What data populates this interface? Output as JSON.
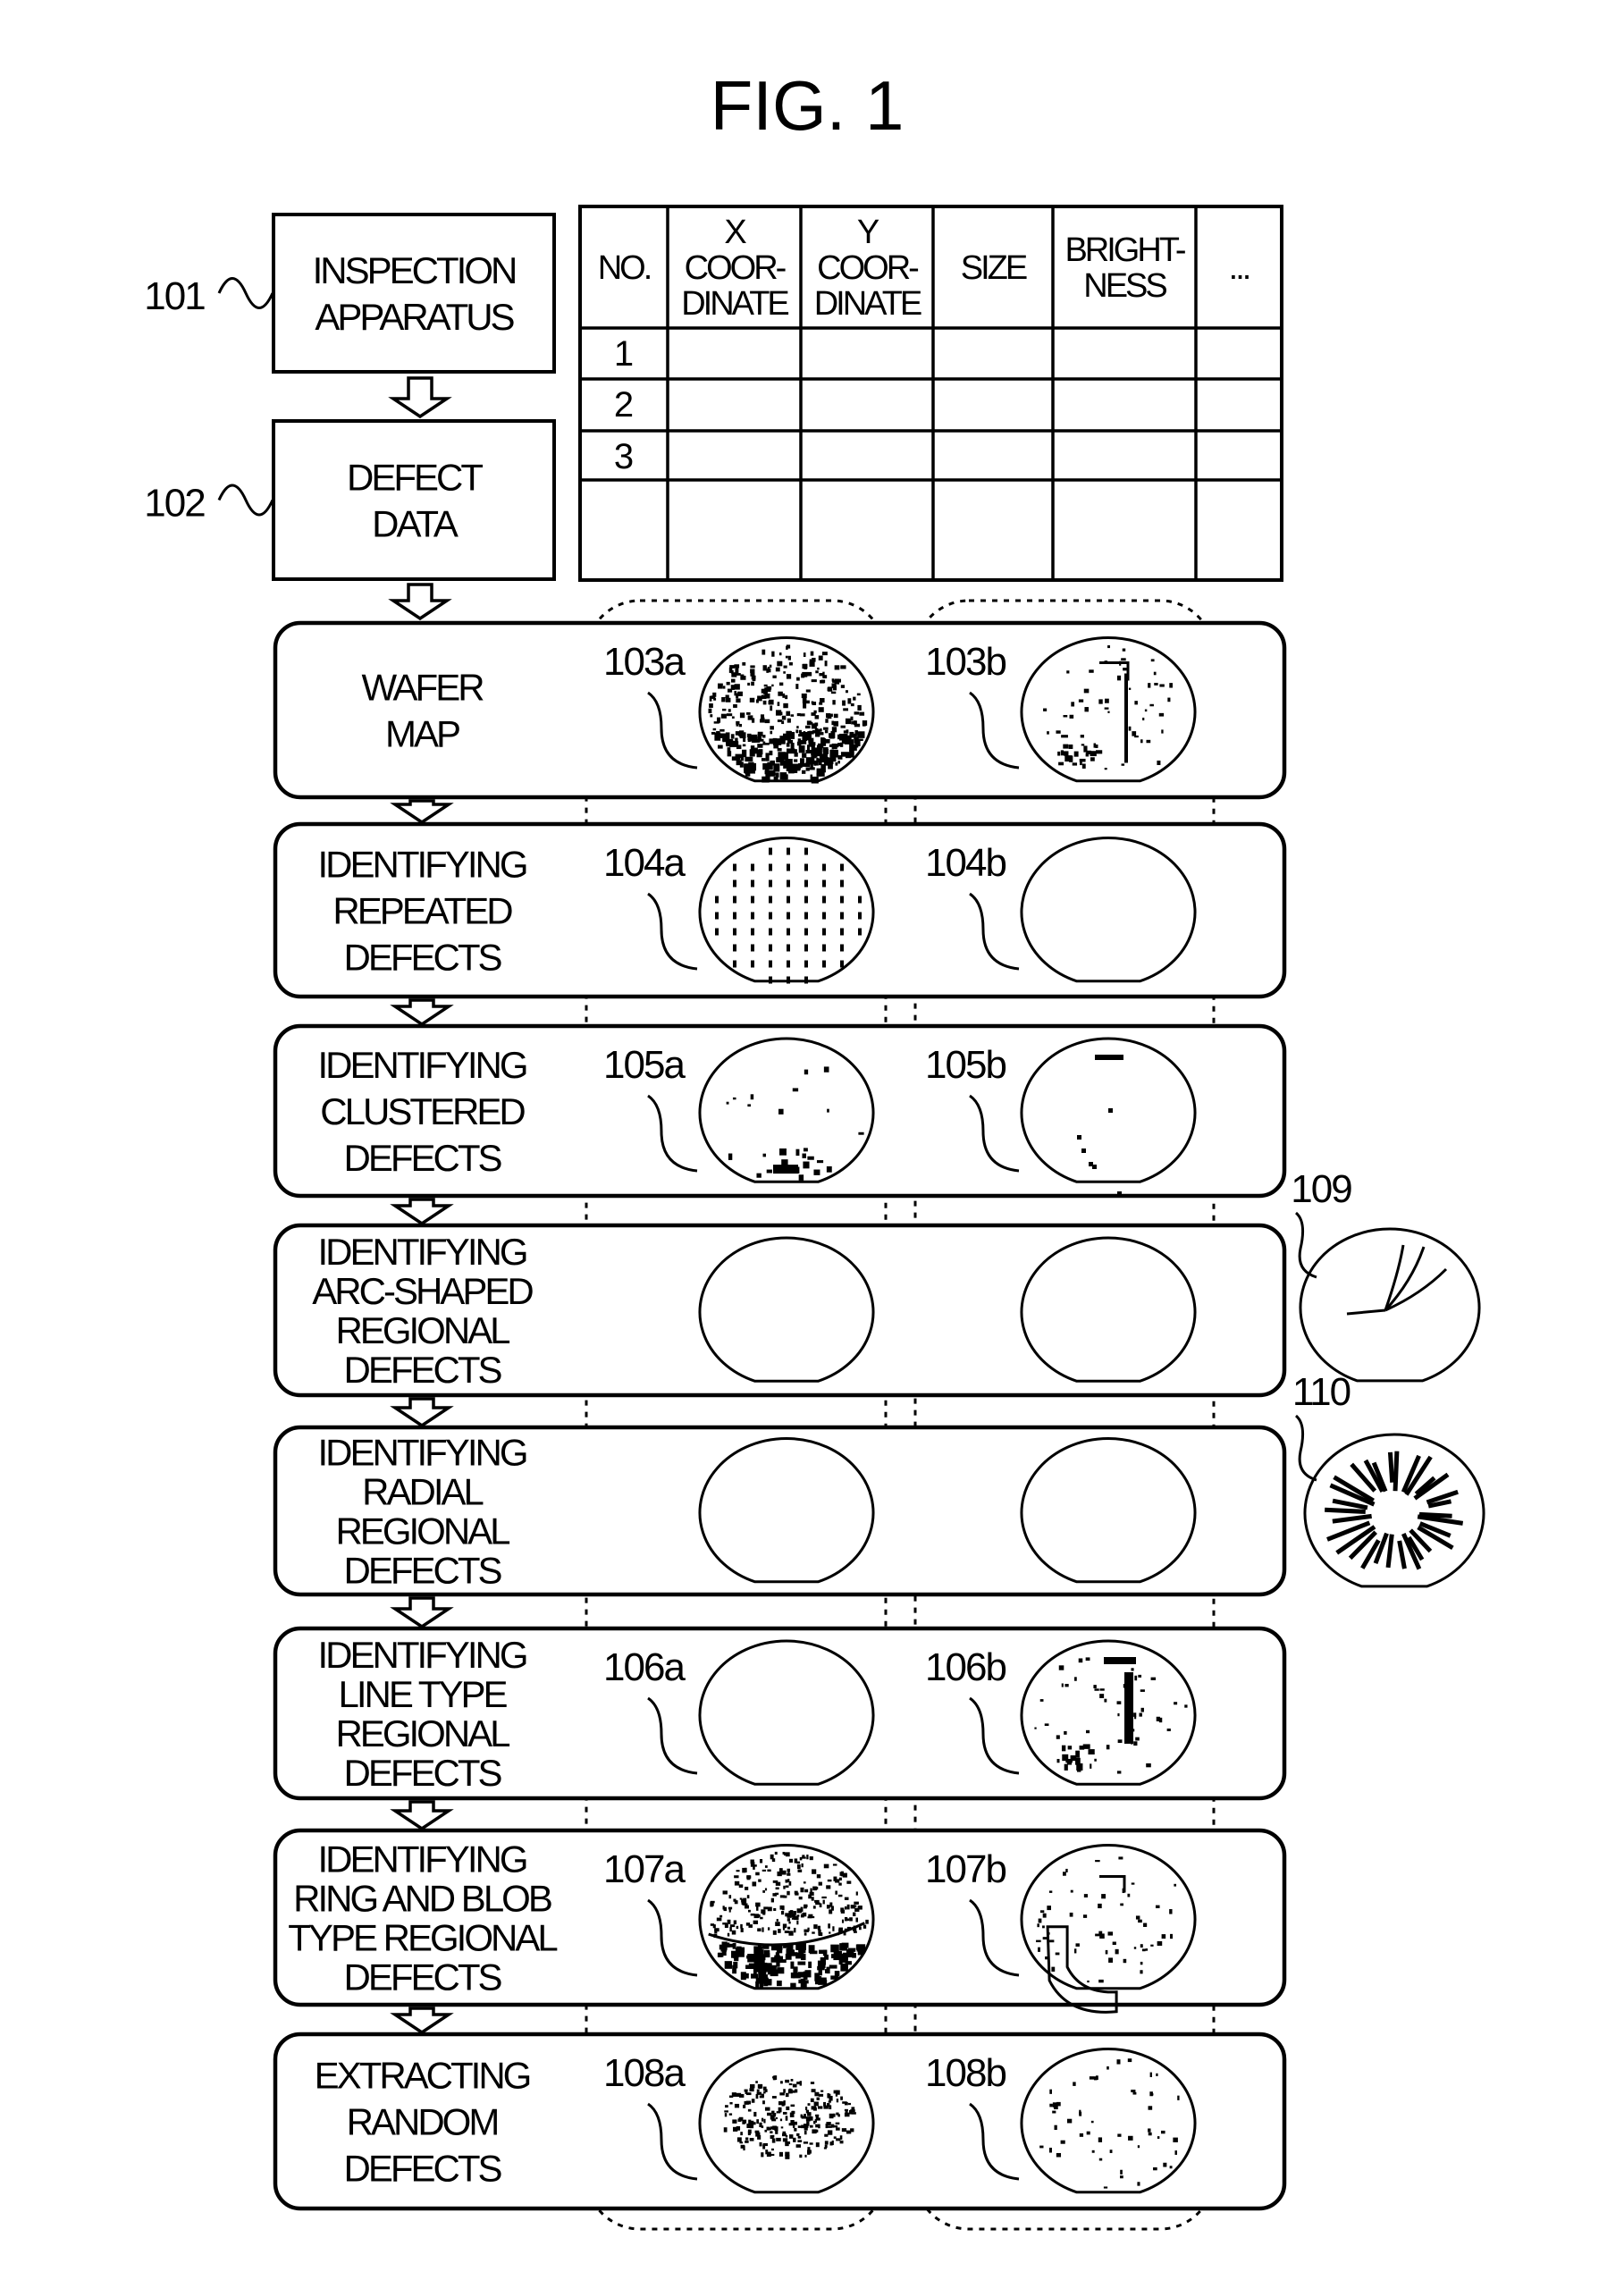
{
  "figure_title": "FIG. 1",
  "input_blocks": [
    {
      "ref": "101",
      "lines": [
        "INSPECTION",
        "APPARATUS"
      ]
    },
    {
      "ref": "102",
      "lines": [
        "DEFECT",
        "DATA"
      ]
    }
  ],
  "defect_table": {
    "columns": [
      {
        "lines": [
          "NO."
        ]
      },
      {
        "lines": [
          "X",
          "COOR-",
          "DINATE"
        ]
      },
      {
        "lines": [
          "Y",
          "COOR-",
          "DINATE"
        ]
      },
      {
        "lines": [
          "SIZE"
        ]
      },
      {
        "lines": [
          "BRIGHT-",
          "NESS"
        ]
      },
      {
        "lines": [
          "..."
        ]
      }
    ],
    "rows": [
      [
        "1",
        "",
        "",
        "",
        "",
        ""
      ],
      [
        "2",
        "",
        "",
        "",
        "",
        ""
      ],
      [
        "3",
        "",
        "",
        "",
        "",
        ""
      ],
      [
        "",
        "",
        "",
        "",
        "",
        ""
      ]
    ]
  },
  "stages": [
    {
      "lines": [
        "WAFER",
        "MAP"
      ],
      "wafer_a": {
        "ref": "103a",
        "pattern": "dense-bottom"
      },
      "wafer_b": {
        "ref": "103b",
        "pattern": "sparse-with-line"
      }
    },
    {
      "lines": [
        "IDENTIFYING",
        "REPEATED",
        "DEFECTS"
      ],
      "wafer_a": {
        "ref": "104a",
        "pattern": "grid"
      },
      "wafer_b": {
        "ref": "104b",
        "pattern": "empty"
      }
    },
    {
      "lines": [
        "IDENTIFYING",
        "CLUSTERED",
        "DEFECTS"
      ],
      "wafer_a": {
        "ref": "105a",
        "pattern": "clusters-bottom"
      },
      "wafer_b": {
        "ref": "105b",
        "pattern": "few-clusters"
      }
    },
    {
      "lines": [
        "IDENTIFYING",
        "ARC-SHAPED",
        "REGIONAL",
        "DEFECTS"
      ],
      "wafer_a": {
        "ref": "",
        "pattern": "empty"
      },
      "wafer_b": {
        "ref": "",
        "pattern": "empty"
      }
    },
    {
      "lines": [
        "IDENTIFYING",
        "RADIAL",
        "REGIONAL",
        "DEFECTS"
      ],
      "wafer_a": {
        "ref": "",
        "pattern": "empty"
      },
      "wafer_b": {
        "ref": "",
        "pattern": "empty"
      }
    },
    {
      "lines": [
        "IDENTIFYING",
        "LINE TYPE",
        "REGIONAL",
        "DEFECTS"
      ],
      "wafer_a": {
        "ref": "106a",
        "pattern": "empty"
      },
      "wafer_b": {
        "ref": "106b",
        "pattern": "line"
      }
    },
    {
      "lines": [
        "IDENTIFYING",
        "RING AND BLOB",
        "TYPE REGIONAL",
        "DEFECTS"
      ],
      "wafer_a": {
        "ref": "107a",
        "pattern": "ring-bottom"
      },
      "wafer_b": {
        "ref": "107b",
        "pattern": "blob"
      }
    },
    {
      "lines": [
        "EXTRACTING",
        "RANDOM",
        "DEFECTS"
      ],
      "wafer_a": {
        "ref": "108a",
        "pattern": "random-dense"
      },
      "wafer_b": {
        "ref": "108b",
        "pattern": "random-sparse"
      }
    }
  ],
  "examples": [
    {
      "ref": "109",
      "pattern": "arc"
    },
    {
      "ref": "110",
      "pattern": "radial"
    }
  ]
}
